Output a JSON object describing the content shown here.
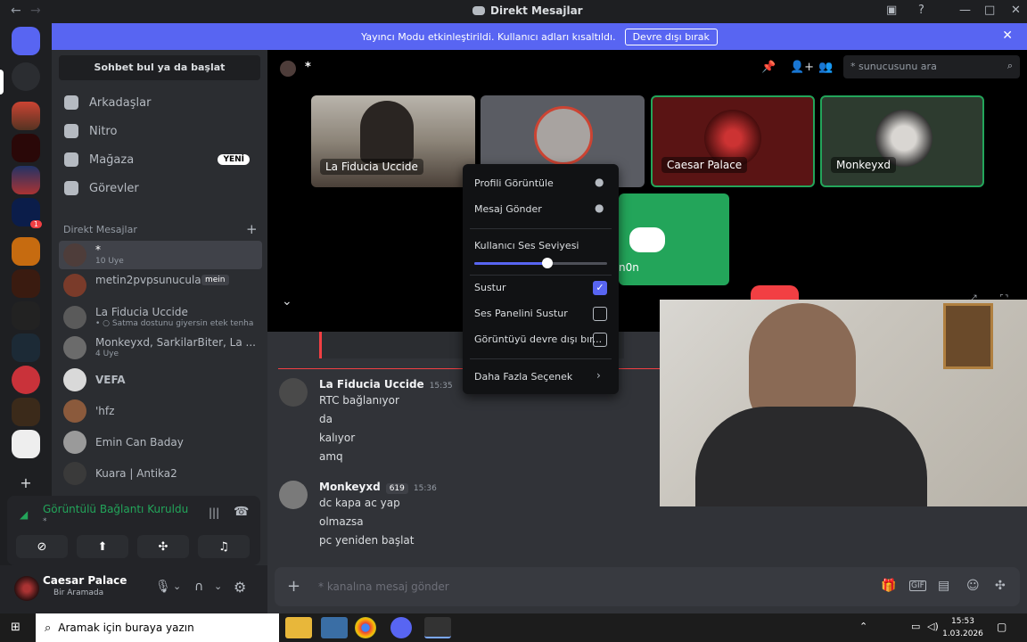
{
  "window": {
    "title": "Direkt Mesajlar"
  },
  "banner": {
    "text": "Yayıncı Modu etkinleştirildi. Kullanıcı adları kısaltıldı.",
    "button": "Devre dışı bırak"
  },
  "servers": {
    "badge": "1"
  },
  "sidebar": {
    "search": "Sohbet bul ya da başlat",
    "nav": [
      {
        "label": "Arkadaşlar"
      },
      {
        "label": "Nitro"
      },
      {
        "label": "Mağaza",
        "badge": "YENİ"
      },
      {
        "label": "Görevler"
      }
    ],
    "dm_header": "Direkt Mesajlar",
    "dms": [
      {
        "name": "*",
        "sub": "10 Üye"
      },
      {
        "name": "metin2pvpsunucular",
        "tag": "mein"
      },
      {
        "name": "La Fiducia Uccide",
        "sub": "• ○ Satma dostunu giyersin etek tenha c"
      },
      {
        "name": "Monkeyxd, SarkilarBiter, La ...",
        "sub": "4 Üye"
      },
      {
        "name": "VEFA"
      },
      {
        "name": "'hfz"
      },
      {
        "name": "Emin Can Baday"
      },
      {
        "name": "Kuara | Antika2"
      }
    ]
  },
  "voice": {
    "status": "Görüntülü Bağlantı Kuruldu",
    "channel": "*"
  },
  "user": {
    "name": "Caesar Palace",
    "status": "Bir Aramada"
  },
  "call": {
    "topic": "*",
    "search_placeholder": "* sunucusunu ara",
    "tiles": [
      {
        "label": "La Fiducia Uccide"
      },
      {
        "label": ""
      },
      {
        "label": "Caesar Palace"
      },
      {
        "label": "Monkeyxd"
      }
    ],
    "bot_label": "n0n"
  },
  "context_menu": {
    "items": [
      "Profili Görüntüle",
      "Mesaj Gönder"
    ],
    "volume_label": "Kullanıcı Ses Seviyesi",
    "volume_level": 0.55,
    "toggles": [
      {
        "label": "Sustur",
        "checked": true
      },
      {
        "label": "Ses Panelini Sustur",
        "checked": false
      },
      {
        "label": "Görüntüyü devre dışı bır...",
        "checked": false
      }
    ],
    "more": "Daha Fazla Seçenek"
  },
  "messages": [
    {
      "author": "La Fiducia Uccide",
      "time": "15:35",
      "lines": [
        "RTC bağlanıyor",
        "da",
        "kalıyor",
        "amq"
      ]
    },
    {
      "author": "Monkeyxd",
      "badge": "619",
      "time": "15:36",
      "lines": [
        "dc kapa ac yap",
        "olmazsa",
        "pc yeniden başlat"
      ]
    }
  ],
  "composer": {
    "placeholder": "* kanalına mesaj gönder"
  },
  "taskbar": {
    "search": "Aramak için buraya yazın",
    "time": "15:53",
    "date": "1.03.2026"
  }
}
